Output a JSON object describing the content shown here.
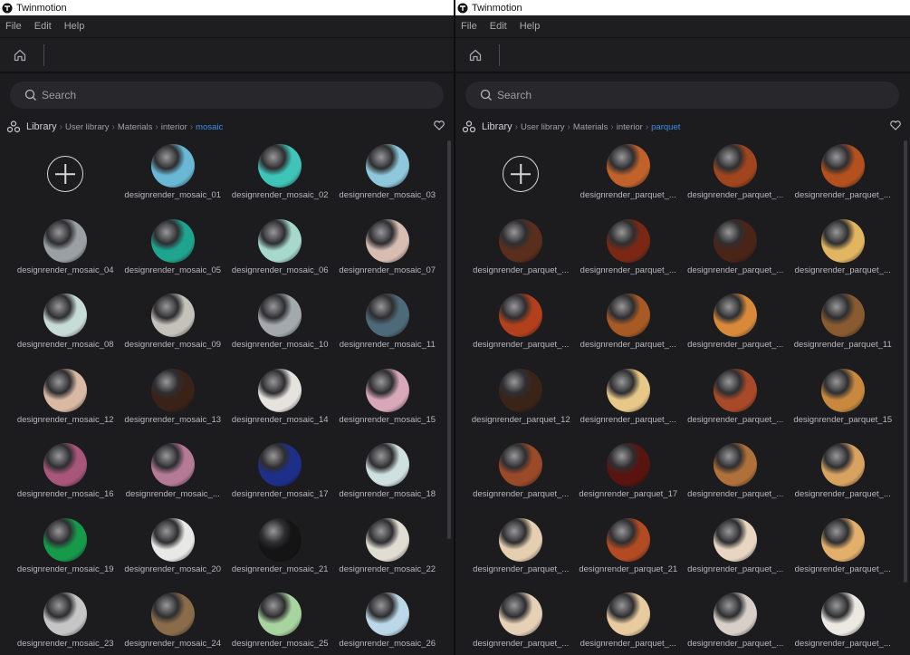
{
  "windows": [
    {
      "app_title": "Twinmotion",
      "menu": [
        "File",
        "Edit",
        "Help"
      ],
      "search_placeholder": "Search",
      "breadcrumb": [
        "Library",
        "User library",
        "Materials",
        "interior",
        "mosaic"
      ],
      "items": [
        {
          "label": "",
          "swatch": "#ffffff"
        },
        {
          "label": "designrender_mosaic_01",
          "swatch": "#6ab8d6"
        },
        {
          "label": "designrender_mosaic_02",
          "swatch": "#3fc4b8"
        },
        {
          "label": "designrender_mosaic_03",
          "swatch": "#8fc8dc"
        },
        {
          "label": "designrender_mosaic_04",
          "swatch": "#9aa0a3"
        },
        {
          "label": "designrender_mosaic_05",
          "swatch": "#1fa48f"
        },
        {
          "label": "designrender_mosaic_06",
          "swatch": "#a6d8cc"
        },
        {
          "label": "designrender_mosaic_07",
          "swatch": "#d7bdb2"
        },
        {
          "label": "designrender_mosaic_08",
          "swatch": "#c8dcd6"
        },
        {
          "label": "designrender_mosaic_09",
          "swatch": "#c5c2bc"
        },
        {
          "label": "designrender_mosaic_10",
          "swatch": "#a3a9ad"
        },
        {
          "label": "designrender_mosaic_11",
          "swatch": "#4e6a78"
        },
        {
          "label": "designrender_mosaic_12",
          "swatch": "#d9b9a4"
        },
        {
          "label": "designrender_mosaic_13",
          "swatch": "#3a2218"
        },
        {
          "label": "designrender_mosaic_14",
          "swatch": "#e6e2de"
        },
        {
          "label": "designrender_mosaic_15",
          "swatch": "#d8a8b8"
        },
        {
          "label": "designrender_mosaic_16",
          "swatch": "#a8567a"
        },
        {
          "label": "designrender_mosaic_...",
          "swatch": "#b47a96"
        },
        {
          "label": "designrender_mosaic_17",
          "swatch": "#1e2f8a"
        },
        {
          "label": "designrender_mosaic_18",
          "swatch": "#cfe0e0"
        },
        {
          "label": "designrender_mosaic_19",
          "swatch": "#169a4a"
        },
        {
          "label": "designrender_mosaic_20",
          "swatch": "#e8e8e6"
        },
        {
          "label": "designrender_mosaic_21",
          "swatch": "#141414"
        },
        {
          "label": "designrender_mosaic_22",
          "swatch": "#e2ddd2"
        },
        {
          "label": "designrender_mosaic_23",
          "swatch": "#c6c6c6"
        },
        {
          "label": "designrender_mosaic_24",
          "swatch": "#8a6b4a"
        },
        {
          "label": "designrender_mosaic_25",
          "swatch": "#a8d4a0"
        },
        {
          "label": "designrender_mosaic_26",
          "swatch": "#bcd8e8"
        }
      ]
    },
    {
      "app_title": "Twinmotion",
      "menu": [
        "File",
        "Edit",
        "Help"
      ],
      "search_placeholder": "Search",
      "breadcrumb": [
        "Library",
        "User library",
        "Materials",
        "interior",
        "parquet"
      ],
      "items": [
        {
          "label": "",
          "swatch": "#ffffff"
        },
        {
          "label": "designrender_parquet_...",
          "swatch": "#c0622a"
        },
        {
          "label": "designrender_parquet_...",
          "swatch": "#a0451e"
        },
        {
          "label": "designrender_parquet_...",
          "swatch": "#b4501e"
        },
        {
          "label": "designrender_parquet_...",
          "swatch": "#5a2e1c"
        },
        {
          "label": "designrender_parquet_...",
          "swatch": "#7a2814"
        },
        {
          "label": "designrender_parquet_...",
          "swatch": "#4a2416"
        },
        {
          "label": "designrender_parquet_...",
          "swatch": "#e2b560"
        },
        {
          "label": "designrender_parquet_...",
          "swatch": "#b3401c"
        },
        {
          "label": "designrender_parquet_...",
          "swatch": "#a85a24"
        },
        {
          "label": "designrender_parquet_...",
          "swatch": "#d88a3a"
        },
        {
          "label": "designrender_parquet_11",
          "swatch": "#8a5a30"
        },
        {
          "label": "designrender_parquet_12",
          "swatch": "#3a2418"
        },
        {
          "label": "designrender_parquet_...",
          "swatch": "#e8c888"
        },
        {
          "label": "designrender_parquet_...",
          "swatch": "#a84a28"
        },
        {
          "label": "designrender_parquet_15",
          "swatch": "#c8893e"
        },
        {
          "label": "designrender_parquet_...",
          "swatch": "#9a4a28"
        },
        {
          "label": "designrender_parquet_17",
          "swatch": "#5a1410"
        },
        {
          "label": "designrender_parquet_...",
          "swatch": "#b0703a"
        },
        {
          "label": "designrender_parquet_...",
          "swatch": "#d8a260"
        },
        {
          "label": "designrender_parquet_...",
          "swatch": "#e6cfb0"
        },
        {
          "label": "designrender_parquet_21",
          "swatch": "#b24a22"
        },
        {
          "label": "designrender_parquet_...",
          "swatch": "#e8d6c2"
        },
        {
          "label": "designrender_parquet_...",
          "swatch": "#e2b06a"
        },
        {
          "label": "designrender_parquet_...",
          "swatch": "#e6d0b6"
        },
        {
          "label": "designrender_parquet_...",
          "swatch": "#e8cca0"
        },
        {
          "label": "designrender_parquet_...",
          "swatch": "#d8d0c8"
        },
        {
          "label": "designrender_parquet_...",
          "swatch": "#ece8e2"
        }
      ]
    }
  ],
  "icons": [
    "twinmotion-logo-icon",
    "home-icon",
    "search-icon",
    "library-icon",
    "chevron-right-icon",
    "heart-icon",
    "add-icon"
  ],
  "colors": {
    "accent": "#3b8ee8",
    "background": "#1c1c1f",
    "search_bg": "#28282c"
  }
}
